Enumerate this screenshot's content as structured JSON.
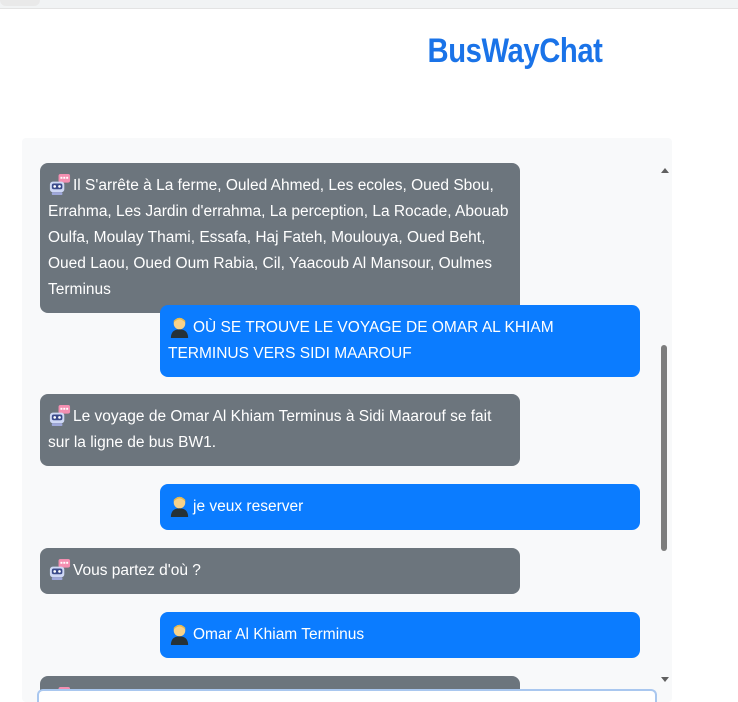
{
  "app": {
    "title": "BusWayChat"
  },
  "messages": [
    {
      "sender": "bot",
      "text": "Il S'arrête à La ferme, Ouled Ahmed, Les ecoles, Oued Sbou, Errahma, Les Jardin d'errahma, La perception, La Rocade, Abouab Oulfa, Moulay Thami, Essafa, Haj Fateh, Moulouya, Oued Beht, Oued Laou, Oued Oum Rabia, Cil, Yaacoub Al Mansour, Oulmes Terminus"
    },
    {
      "sender": "user",
      "text": "OÙ SE TROUVE LE VOYAGE DE OMAR AL KHIAM TERMINUS VERS SIDI MAAROUF"
    },
    {
      "sender": "bot",
      "text": "Le voyage de Omar Al Khiam Terminus à Sidi Maarouf se fait sur la ligne de bus BW1."
    },
    {
      "sender": "user",
      "text": "je veux reserver"
    },
    {
      "sender": "bot",
      "text": "Vous partez d'où ?"
    },
    {
      "sender": "user",
      "text": "Omar Al Khiam Terminus"
    },
    {
      "sender": "bot",
      "text": ""
    }
  ],
  "icons": {
    "bot": "robot-icon",
    "user": "user-avatar-icon"
  },
  "colors": {
    "title": "#1a73e8",
    "bot_bubble": "#6c757d",
    "user_bubble": "#0b7cff",
    "panel": "#f8f9fa"
  }
}
